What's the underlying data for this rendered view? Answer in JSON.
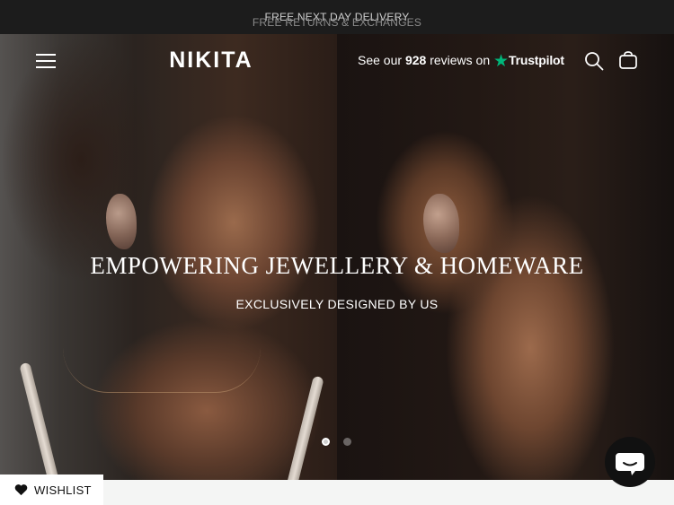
{
  "announcement": {
    "message_1": "FREE NEXT DAY DELIVERY",
    "message_2": "FREE RETURNS & EXCHANGES"
  },
  "header": {
    "logo": "NIKITA",
    "trustpilot": {
      "prefix": "See our",
      "count": "928",
      "suffix": "reviews on",
      "brand": "Trustpilot",
      "star_color": "#00b67a"
    },
    "icons": [
      "menu-icon",
      "search-icon",
      "bag-icon"
    ]
  },
  "hero": {
    "title": "EMPOWERING JEWELLERY & HOMEWARE",
    "subtitle": "EXCLUSIVELY DESIGNED BY US",
    "slides": 2,
    "active_slide": 1
  },
  "wishlist": {
    "label": "WISHLIST"
  },
  "chat": {
    "icon": "chat-icon"
  }
}
